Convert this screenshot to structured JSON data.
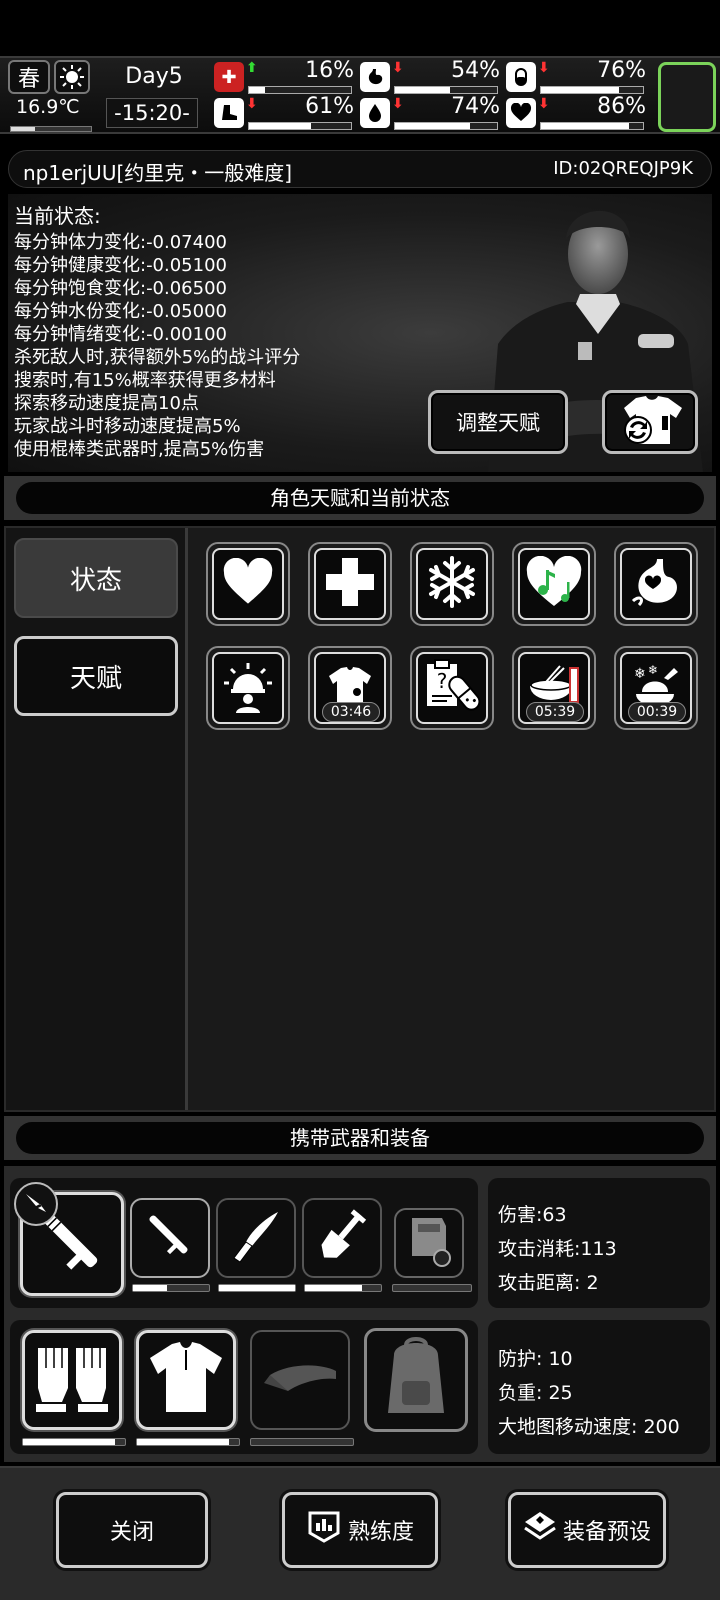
{
  "topbar": {
    "season": "春",
    "weather_icon": "sun-icon",
    "temperature": "16.9℃",
    "temperature_level": 0.3,
    "day": "Day5",
    "time": "-15:20-",
    "stats": [
      {
        "name": "health",
        "icon": "first-aid-icon",
        "trend": "up",
        "value": "16%",
        "level": 0.16
      },
      {
        "name": "hunger",
        "icon": "stomach-icon",
        "trend": "down",
        "value": "54%",
        "level": 0.54
      },
      {
        "name": "stamina",
        "icon": "pill-icon",
        "trend": "down",
        "value": "76%",
        "level": 0.76
      },
      {
        "name": "energy",
        "icon": "boot-icon",
        "trend": "down",
        "value": "61%",
        "level": 0.61
      },
      {
        "name": "water",
        "icon": "water-drop-icon",
        "trend": "down",
        "value": "74%",
        "level": 0.74
      },
      {
        "name": "mood",
        "icon": "heart-icon",
        "trend": "down",
        "value": "86%",
        "level": 0.86
      }
    ],
    "trend_colors": {
      "up": "#33dd33",
      "down": "#ff3333"
    },
    "minimap_border": "#7bd35a"
  },
  "character": {
    "name": "np1erjUU[约里克・一般难度]",
    "id": "ID:02QREQJP9K"
  },
  "status": {
    "title": "当前状态:",
    "lines": [
      "每分钟体力变化:-0.07400",
      "每分钟健康变化:-0.05100",
      "每分钟饱食变化:-0.06500",
      "每分钟水份变化:-0.05000",
      "每分钟情绪变化:-0.00100",
      "杀死敌人时,获得额外5%的战斗评分",
      "搜索时,有15%概率获得更多材料",
      "探索移动速度提高10点",
      "玩家战斗时移动速度提高5%",
      "使用棍棒类武器时,提高5%伤害"
    ],
    "adjust_button": "调整天赋",
    "outfit_button_icon": "swap-outfit-icon"
  },
  "talents_section": {
    "title": "角色天赋和当前状态",
    "tabs": [
      "状态",
      "天赋"
    ],
    "active_tab": "状态",
    "effects": [
      {
        "icon": "heart-icon",
        "timer": ""
      },
      {
        "icon": "plus-icon",
        "timer": ""
      },
      {
        "icon": "snowflake-icon",
        "timer": ""
      },
      {
        "icon": "music-heart-icon",
        "timer": ""
      },
      {
        "icon": "heart-stomach-icon",
        "timer": ""
      },
      {
        "icon": "alarm-person-icon",
        "timer": ""
      },
      {
        "icon": "clean-shirt-icon",
        "timer": "03:46"
      },
      {
        "icon": "medical-report-icon",
        "timer": ""
      },
      {
        "icon": "hot-meal-icon",
        "timer": "05:39"
      },
      {
        "icon": "cold-food-icon",
        "timer": "00:39"
      }
    ]
  },
  "equipment_section": {
    "title": "携带武器和装备",
    "weapons": [
      {
        "icon": "baton-icon",
        "durability": null
      },
      {
        "icon": "baton-icon",
        "durability": 0.45
      },
      {
        "icon": "knife-icon",
        "durability": 1.0
      },
      {
        "icon": "shovel-icon",
        "durability": 0.75
      },
      {
        "icon": "riot-shield-icon",
        "durability": 0
      }
    ],
    "weapon_stats": [
      "伤害:63",
      "攻击消耗:113",
      "攻击距离: 2"
    ],
    "gear": [
      {
        "icon": "gloves-icon",
        "durability": 0.9
      },
      {
        "icon": "shirt-icon",
        "durability": 0.9
      },
      {
        "icon": "cap-icon",
        "durability": 0
      },
      {
        "icon": "backpack-icon",
        "durability": null
      }
    ],
    "gear_stats": [
      "防护: 10",
      "负重: 25",
      "大地图移动速度: 200"
    ]
  },
  "bottom_buttons": {
    "close": "关闭",
    "proficiency": "熟练度",
    "preset": "装备预设"
  }
}
